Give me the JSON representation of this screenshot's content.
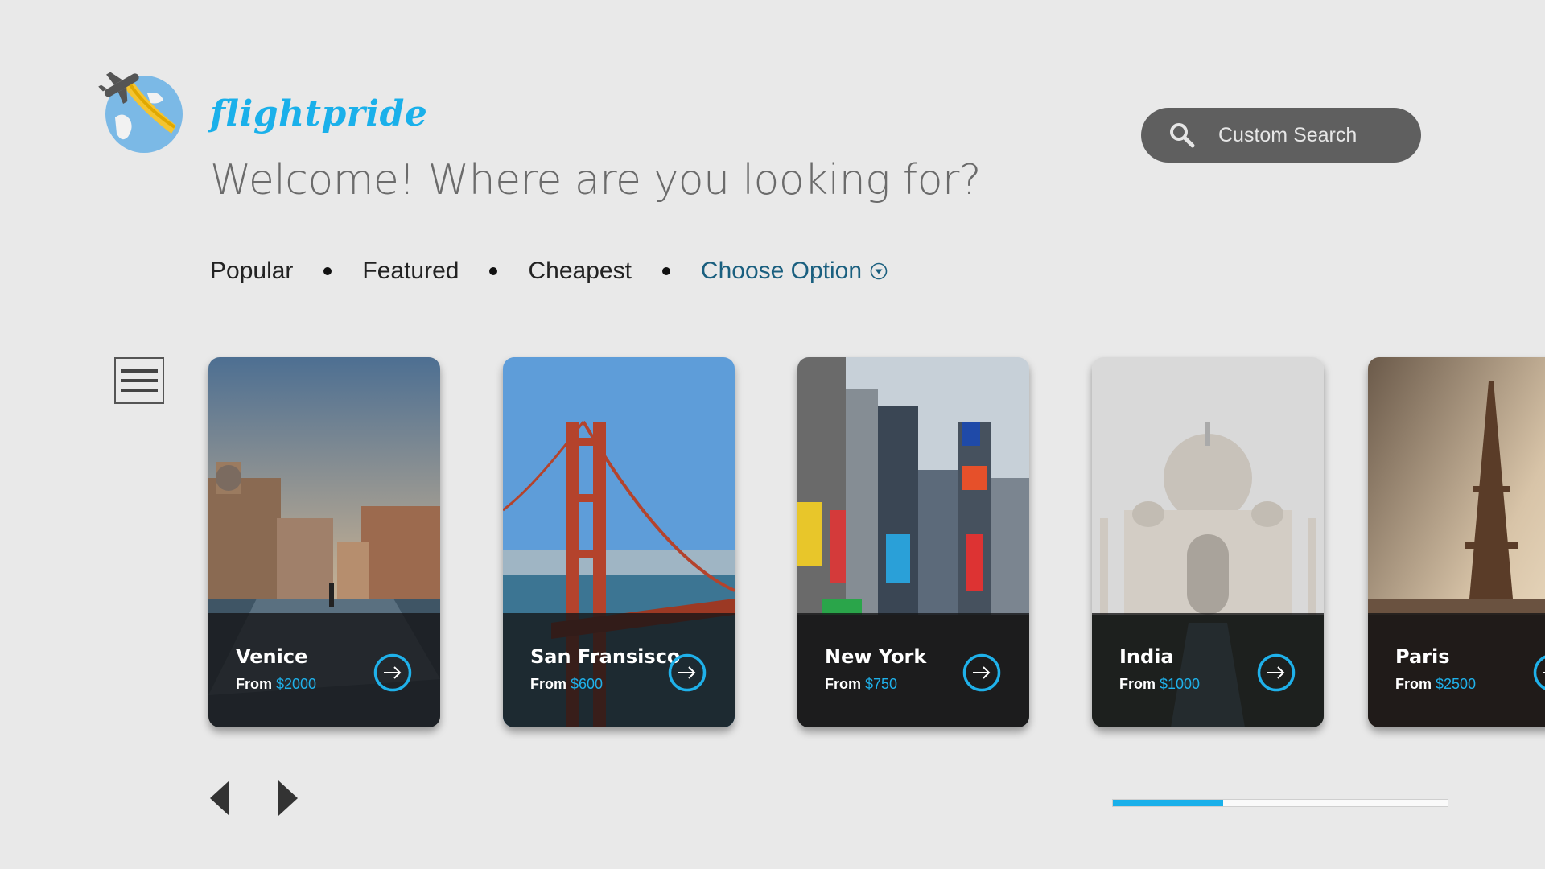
{
  "brand": {
    "name": "flightpride"
  },
  "header": {
    "welcome": "Welcome! Where are you looking for?"
  },
  "search": {
    "label": "Custom Search",
    "icon": "search-icon"
  },
  "tabs": [
    {
      "label": "Popular"
    },
    {
      "label": "Featured"
    },
    {
      "label": "Cheapest"
    },
    {
      "label": "Choose Option",
      "icon": "chevron-down-circle-icon"
    }
  ],
  "menu": {
    "icon": "hamburger-menu-icon"
  },
  "destinations": [
    {
      "city": "Venice",
      "from": "From",
      "price": "$2000"
    },
    {
      "city": "San Fransisco",
      "from": "From",
      "price": "$600"
    },
    {
      "city": "New York",
      "from": "From",
      "price": "$750"
    },
    {
      "city": "India",
      "from": "From",
      "price": "$1000"
    },
    {
      "city": "Paris",
      "from": "From",
      "price": "$2500"
    }
  ],
  "carousel": {
    "progress": 0.33
  },
  "colors": {
    "accent": "#1ab0ea",
    "background": "#e9e9e9",
    "search_bg": "#5f5f5f",
    "choose_option": "#1a5f7f"
  }
}
